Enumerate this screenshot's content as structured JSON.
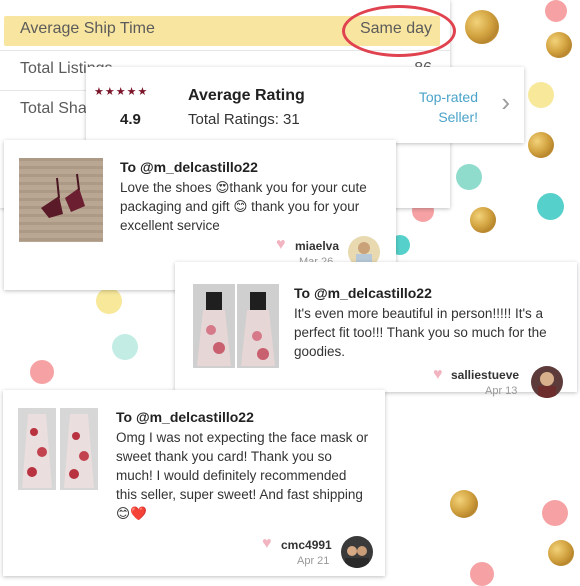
{
  "stats": {
    "rows": [
      {
        "label": "Average Ship Time",
        "value": "Same day"
      },
      {
        "label": "Total Listings",
        "value": "86"
      },
      {
        "label": "Total Shares",
        "value": ""
      }
    ]
  },
  "rating": {
    "stars": "★★★★★",
    "score": "4.9",
    "title": "Average Rating",
    "total": "Total Ratings: 31",
    "badge_line1": "Top-rated",
    "badge_line2": "Seller!"
  },
  "reviews": [
    {
      "to": "To @m_delcastillo22",
      "message": "Love the shoes 😍thank you for your cute packaging and gift 😊 thank you for your excellent service",
      "user": "miaelva",
      "date": "Mar 26"
    },
    {
      "to": "To @m_delcastillo22",
      "message": "It's even more beautiful in person!!!!! It's a perfect fit too!!! Thank you so much for the goodies.",
      "user": "salliestueve",
      "date": "Apr 13"
    },
    {
      "to": "To @m_delcastillo22",
      "message": "Omg I was not expecting the face mask or sweet thank you card! Thank you so much! I would definitely recommended this seller, super sweet! And fast shipping 😊❤️",
      "user": "cmc4991",
      "date": "Apr 21"
    }
  ],
  "colors": {
    "accent_blue": "#4aa3c9",
    "star_color": "#7a1428",
    "circle_red": "#e0434f",
    "highlight_yellow": "#f7e08e",
    "dot_pink": "#f6a2a4",
    "dot_mint": "#8fdccd",
    "dot_teal": "#56d0ca",
    "dot_yellow": "#f7e89a"
  }
}
